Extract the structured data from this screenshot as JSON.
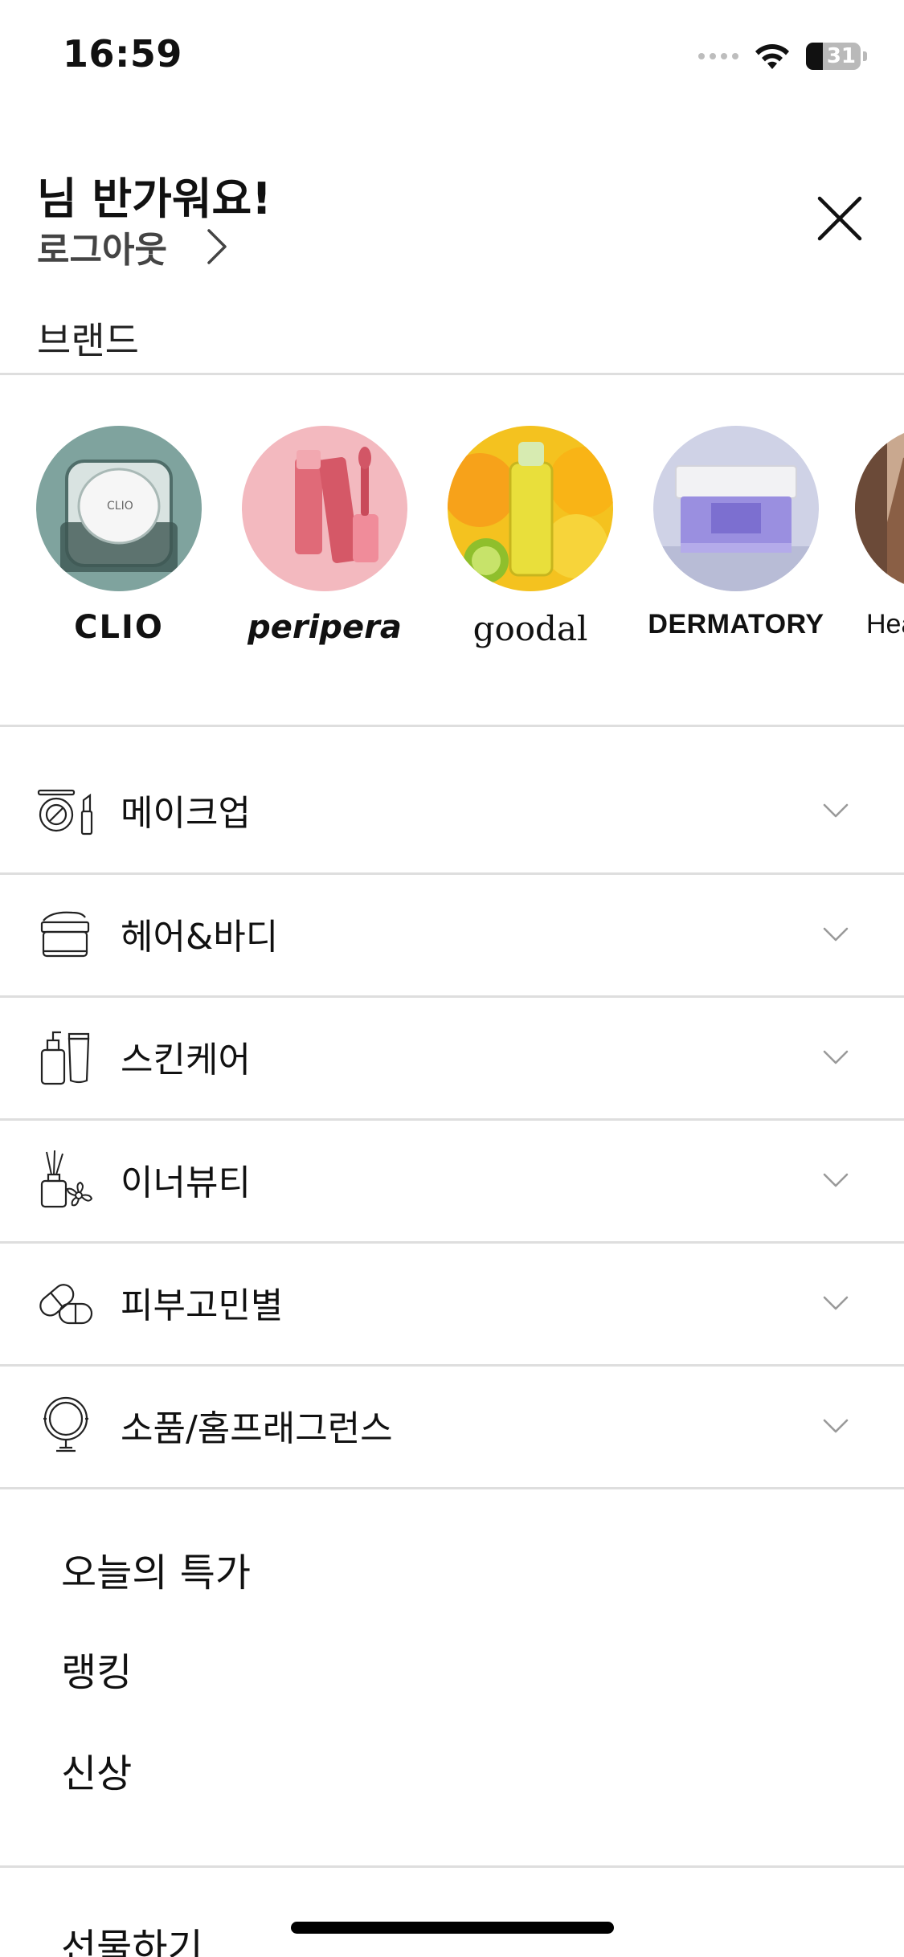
{
  "status_bar": {
    "time": "16:59",
    "battery_level": "31",
    "battery_fraction": 0.31,
    "icons": [
      "cellular-signal-icon",
      "wifi-icon",
      "battery-icon"
    ]
  },
  "header": {
    "greeting": "님 반가워요!",
    "logout_label": "로그아웃",
    "close_icon": "close-icon"
  },
  "brands_section": {
    "title": "브랜드",
    "brands": [
      {
        "name": "CLIO"
      },
      {
        "name": "peripera"
      },
      {
        "name": "goodal"
      },
      {
        "name": "DERMATORY"
      },
      {
        "name": "Hea"
      }
    ]
  },
  "categories": [
    {
      "label": "메이크업",
      "icon": "makeup-icon"
    },
    {
      "label": "헤어&바디",
      "icon": "cream-jar-icon"
    },
    {
      "label": "스킨케어",
      "icon": "skincare-bottles-icon"
    },
    {
      "label": "이너뷰티",
      "icon": "diffuser-flower-icon"
    },
    {
      "label": "피부고민별",
      "icon": "pills-icon"
    },
    {
      "label": "소품/홈프래그런스",
      "icon": "mirror-icon"
    }
  ],
  "menu_links": [
    {
      "label": "오늘의 특가"
    },
    {
      "label": "랭킹"
    },
    {
      "label": "신상"
    },
    {
      "label": "선물하기"
    }
  ],
  "colors": {
    "divider": "#dedede",
    "text": "#111111",
    "muted_text": "#444444",
    "chevron": "#9a9a9a"
  }
}
